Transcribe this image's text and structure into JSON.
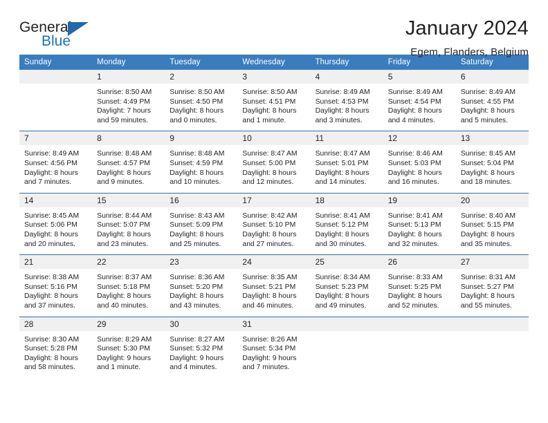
{
  "brand": {
    "name_part1": "General",
    "name_part2": "Blue",
    "triangle_color": "#1f69ad"
  },
  "header": {
    "title": "January 2024",
    "subtitle": "Egem, Flanders, Belgium"
  },
  "colors": {
    "header_blue": "#3a7dbf",
    "separator_blue": "#2f6fb0",
    "daynum_band": "#f0f0f0",
    "text": "#231f20"
  },
  "weekday_headers": [
    "Sunday",
    "Monday",
    "Tuesday",
    "Wednesday",
    "Thursday",
    "Friday",
    "Saturday"
  ],
  "weeks": [
    [
      {
        "day": "",
        "lines": []
      },
      {
        "day": "1",
        "lines": [
          "Sunrise: 8:50 AM",
          "Sunset: 4:49 PM",
          "Daylight: 7 hours",
          "and 59 minutes."
        ]
      },
      {
        "day": "2",
        "lines": [
          "Sunrise: 8:50 AM",
          "Sunset: 4:50 PM",
          "Daylight: 8 hours",
          "and 0 minutes."
        ]
      },
      {
        "day": "3",
        "lines": [
          "Sunrise: 8:50 AM",
          "Sunset: 4:51 PM",
          "Daylight: 8 hours",
          "and 1 minute."
        ]
      },
      {
        "day": "4",
        "lines": [
          "Sunrise: 8:49 AM",
          "Sunset: 4:53 PM",
          "Daylight: 8 hours",
          "and 3 minutes."
        ]
      },
      {
        "day": "5",
        "lines": [
          "Sunrise: 8:49 AM",
          "Sunset: 4:54 PM",
          "Daylight: 8 hours",
          "and 4 minutes."
        ]
      },
      {
        "day": "6",
        "lines": [
          "Sunrise: 8:49 AM",
          "Sunset: 4:55 PM",
          "Daylight: 8 hours",
          "and 5 minutes."
        ]
      }
    ],
    [
      {
        "day": "7",
        "lines": [
          "Sunrise: 8:49 AM",
          "Sunset: 4:56 PM",
          "Daylight: 8 hours",
          "and 7 minutes."
        ]
      },
      {
        "day": "8",
        "lines": [
          "Sunrise: 8:48 AM",
          "Sunset: 4:57 PM",
          "Daylight: 8 hours",
          "and 9 minutes."
        ]
      },
      {
        "day": "9",
        "lines": [
          "Sunrise: 8:48 AM",
          "Sunset: 4:59 PM",
          "Daylight: 8 hours",
          "and 10 minutes."
        ]
      },
      {
        "day": "10",
        "lines": [
          "Sunrise: 8:47 AM",
          "Sunset: 5:00 PM",
          "Daylight: 8 hours",
          "and 12 minutes."
        ]
      },
      {
        "day": "11",
        "lines": [
          "Sunrise: 8:47 AM",
          "Sunset: 5:01 PM",
          "Daylight: 8 hours",
          "and 14 minutes."
        ]
      },
      {
        "day": "12",
        "lines": [
          "Sunrise: 8:46 AM",
          "Sunset: 5:03 PM",
          "Daylight: 8 hours",
          "and 16 minutes."
        ]
      },
      {
        "day": "13",
        "lines": [
          "Sunrise: 8:45 AM",
          "Sunset: 5:04 PM",
          "Daylight: 8 hours",
          "and 18 minutes."
        ]
      }
    ],
    [
      {
        "day": "14",
        "lines": [
          "Sunrise: 8:45 AM",
          "Sunset: 5:06 PM",
          "Daylight: 8 hours",
          "and 20 minutes."
        ]
      },
      {
        "day": "15",
        "lines": [
          "Sunrise: 8:44 AM",
          "Sunset: 5:07 PM",
          "Daylight: 8 hours",
          "and 23 minutes."
        ]
      },
      {
        "day": "16",
        "lines": [
          "Sunrise: 8:43 AM",
          "Sunset: 5:09 PM",
          "Daylight: 8 hours",
          "and 25 minutes."
        ]
      },
      {
        "day": "17",
        "lines": [
          "Sunrise: 8:42 AM",
          "Sunset: 5:10 PM",
          "Daylight: 8 hours",
          "and 27 minutes."
        ]
      },
      {
        "day": "18",
        "lines": [
          "Sunrise: 8:41 AM",
          "Sunset: 5:12 PM",
          "Daylight: 8 hours",
          "and 30 minutes."
        ]
      },
      {
        "day": "19",
        "lines": [
          "Sunrise: 8:41 AM",
          "Sunset: 5:13 PM",
          "Daylight: 8 hours",
          "and 32 minutes."
        ]
      },
      {
        "day": "20",
        "lines": [
          "Sunrise: 8:40 AM",
          "Sunset: 5:15 PM",
          "Daylight: 8 hours",
          "and 35 minutes."
        ]
      }
    ],
    [
      {
        "day": "21",
        "lines": [
          "Sunrise: 8:38 AM",
          "Sunset: 5:16 PM",
          "Daylight: 8 hours",
          "and 37 minutes."
        ]
      },
      {
        "day": "22",
        "lines": [
          "Sunrise: 8:37 AM",
          "Sunset: 5:18 PM",
          "Daylight: 8 hours",
          "and 40 minutes."
        ]
      },
      {
        "day": "23",
        "lines": [
          "Sunrise: 8:36 AM",
          "Sunset: 5:20 PM",
          "Daylight: 8 hours",
          "and 43 minutes."
        ]
      },
      {
        "day": "24",
        "lines": [
          "Sunrise: 8:35 AM",
          "Sunset: 5:21 PM",
          "Daylight: 8 hours",
          "and 46 minutes."
        ]
      },
      {
        "day": "25",
        "lines": [
          "Sunrise: 8:34 AM",
          "Sunset: 5:23 PM",
          "Daylight: 8 hours",
          "and 49 minutes."
        ]
      },
      {
        "day": "26",
        "lines": [
          "Sunrise: 8:33 AM",
          "Sunset: 5:25 PM",
          "Daylight: 8 hours",
          "and 52 minutes."
        ]
      },
      {
        "day": "27",
        "lines": [
          "Sunrise: 8:31 AM",
          "Sunset: 5:27 PM",
          "Daylight: 8 hours",
          "and 55 minutes."
        ]
      }
    ],
    [
      {
        "day": "28",
        "lines": [
          "Sunrise: 8:30 AM",
          "Sunset: 5:28 PM",
          "Daylight: 8 hours",
          "and 58 minutes."
        ]
      },
      {
        "day": "29",
        "lines": [
          "Sunrise: 8:29 AM",
          "Sunset: 5:30 PM",
          "Daylight: 9 hours",
          "and 1 minute."
        ]
      },
      {
        "day": "30",
        "lines": [
          "Sunrise: 8:27 AM",
          "Sunset: 5:32 PM",
          "Daylight: 9 hours",
          "and 4 minutes."
        ]
      },
      {
        "day": "31",
        "lines": [
          "Sunrise: 8:26 AM",
          "Sunset: 5:34 PM",
          "Daylight: 9 hours",
          "and 7 minutes."
        ]
      },
      {
        "day": "",
        "lines": []
      },
      {
        "day": "",
        "lines": []
      },
      {
        "day": "",
        "lines": []
      }
    ]
  ]
}
